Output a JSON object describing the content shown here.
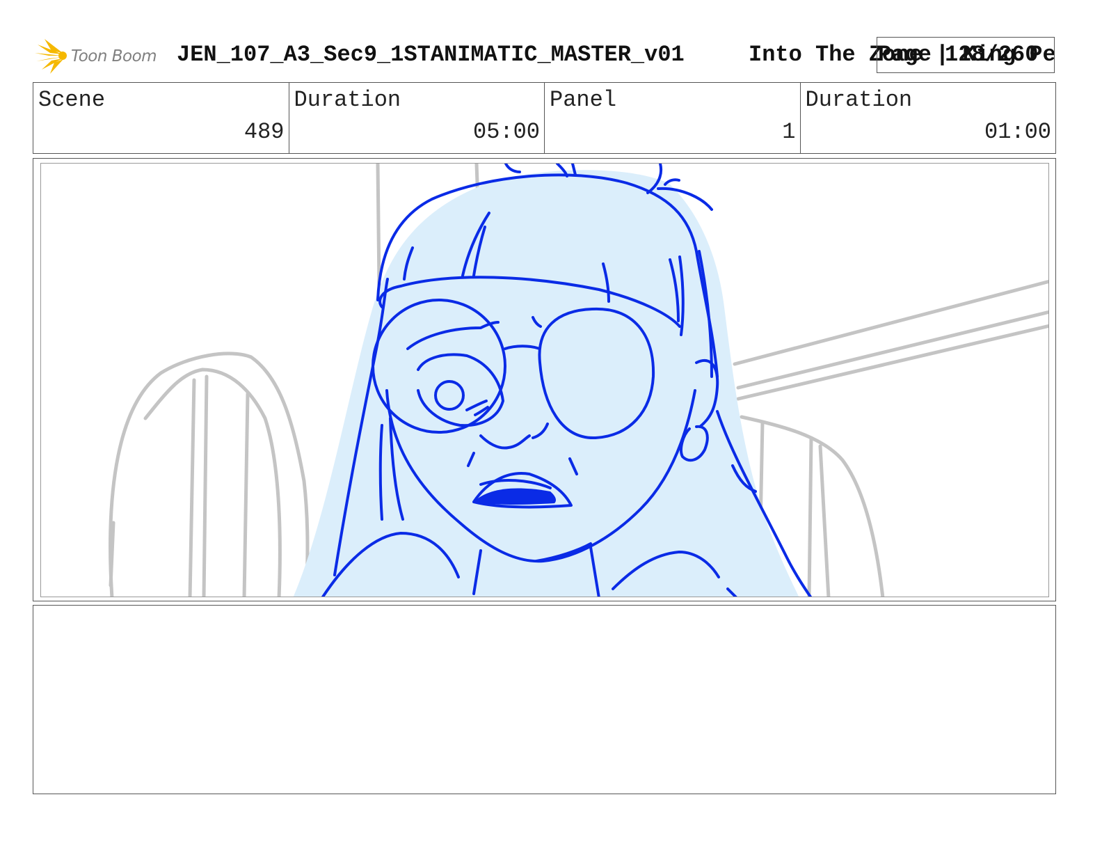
{
  "header": {
    "logo_text": "Toon Boom",
    "document_title": "JEN_107_A3_Sec9_1STANIMATIC_MASTER_v01",
    "show_title": "Into The Zone | King Pe",
    "page_label": "Page 128/260"
  },
  "info_row": {
    "cells": [
      {
        "label": "Scene",
        "value": "489"
      },
      {
        "label": "Duration",
        "value": "05:00"
      },
      {
        "label": "Panel",
        "value": "1"
      },
      {
        "label": "Duration",
        "value": "01:00"
      }
    ]
  },
  "panel": {
    "colors": {
      "sketch_line": "#0a2be6",
      "fill": "#dbeefb",
      "background_line": "#c4c4c4"
    }
  },
  "notes": {
    "text": ""
  }
}
